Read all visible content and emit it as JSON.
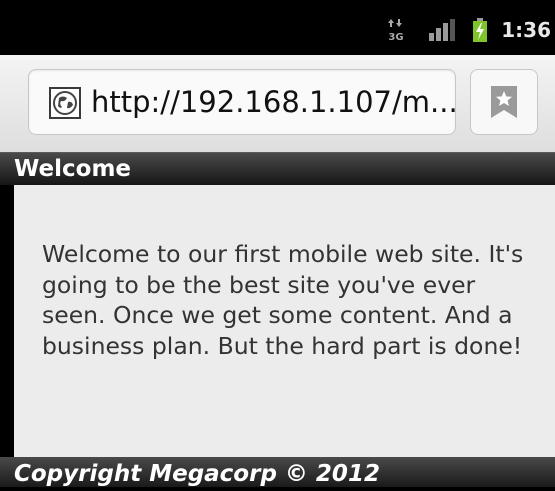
{
  "status_bar": {
    "network_label": "3G",
    "time": "1:36"
  },
  "browser": {
    "url": "http://192.168.1.107/m..."
  },
  "page": {
    "header_title": "Welcome",
    "body_text": "Welcome to our first mobile web site. It's going to be the best site you've ever seen. Once we get some content. And a business plan. But the hard part is done!",
    "footer_text": "Copyright Megacorp © 2012"
  },
  "colors": {
    "header_bar": "#1e1e1e",
    "content_background": "#ececec",
    "battery_green": "#7ec52a"
  }
}
